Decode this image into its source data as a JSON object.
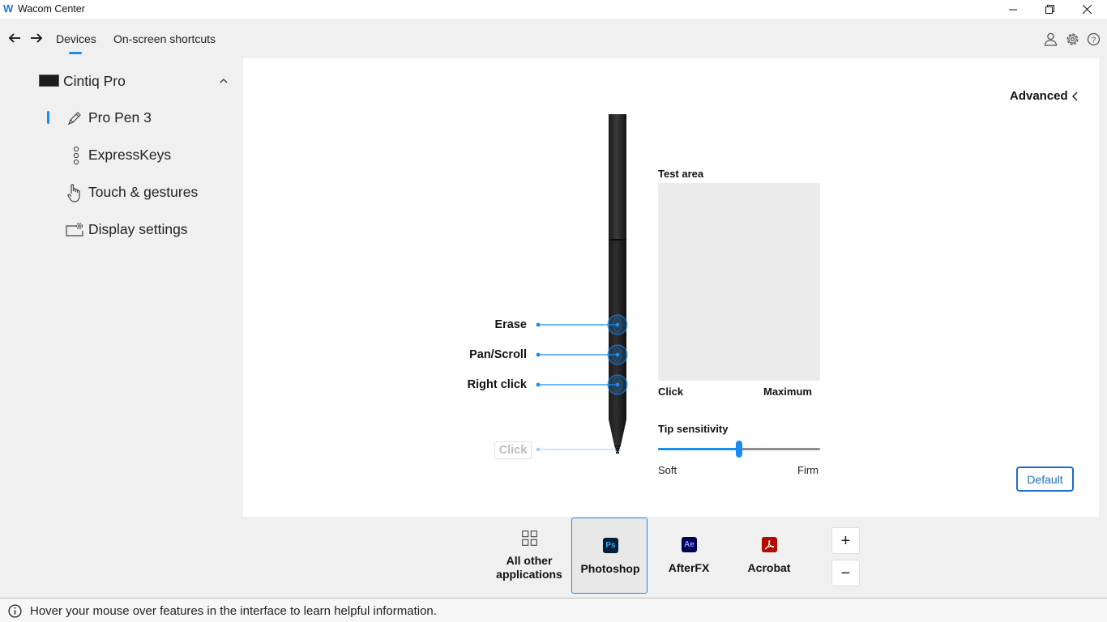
{
  "window": {
    "title": "Wacom Center",
    "logo_icon": "wacom-logo-icon"
  },
  "toolbar": {
    "tabs": [
      {
        "label": "Devices",
        "active": true
      },
      {
        "label": "On-screen shortcuts",
        "active": false
      }
    ],
    "icons": [
      "back-arrow-icon",
      "forward-arrow-icon",
      "user-icon",
      "gear-icon",
      "help-icon"
    ]
  },
  "sidebar": {
    "device": {
      "name": "Cintiq Pro",
      "expanded": true
    },
    "items": [
      {
        "label": "Pro Pen 3",
        "icon": "pen-icon",
        "selected": true
      },
      {
        "label": "ExpressKeys",
        "icon": "expresskeys-icon",
        "selected": false
      },
      {
        "label": "Touch & gestures",
        "icon": "hand-icon",
        "selected": false
      },
      {
        "label": "Display settings",
        "icon": "display-settings-icon",
        "selected": false
      }
    ]
  },
  "main": {
    "advanced_label": "Advanced",
    "pen_buttons": [
      {
        "label": "Erase"
      },
      {
        "label": "Pan/Scroll"
      },
      {
        "label": "Right click"
      },
      {
        "label": "Click",
        "dimmed": true
      }
    ],
    "test_area": {
      "title": "Test area",
      "left_label": "Click",
      "right_label": "Maximum"
    },
    "tip_sensitivity": {
      "title": "Tip sensitivity",
      "min_label": "Soft",
      "max_label": "Firm",
      "value_fraction": 0.5
    },
    "default_button": "Default"
  },
  "applications": {
    "tiles": [
      {
        "label_line1": "All other",
        "label_line2": "applications",
        "icon": "grid-icon",
        "selected": false
      },
      {
        "label": "Photoshop",
        "badge": "Ps",
        "icon": "photoshop-icon",
        "selected": true
      },
      {
        "label": "AfterFX",
        "badge": "Ae",
        "icon": "aftereffects-icon",
        "selected": false
      },
      {
        "label": "Acrobat",
        "icon": "acrobat-icon",
        "selected": false
      }
    ],
    "add_label": "+",
    "remove_label": "−"
  },
  "statusbar": {
    "text": "Hover your mouse over features in the interface to learn helpful information."
  },
  "colors": {
    "accent": "#1a8cf0",
    "panel_bg": "#ffffff",
    "app_bg": "#f0f0f0"
  }
}
